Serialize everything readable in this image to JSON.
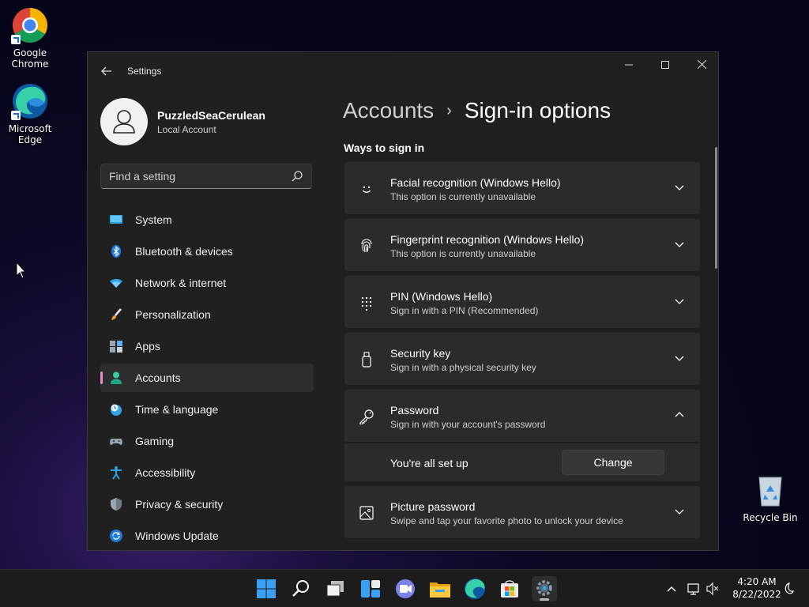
{
  "desktop": {
    "icons": [
      {
        "label_1": "Google",
        "label_2": "Chrome"
      },
      {
        "label_1": "Microsoft",
        "label_2": "Edge"
      },
      {
        "label_1": "Recycle Bin"
      }
    ]
  },
  "window": {
    "title": "Settings",
    "controls": {
      "minimize": "—",
      "maximize": "☐",
      "close": "✕"
    }
  },
  "profile": {
    "name": "PuzzledSeaCerulean",
    "account_type": "Local Account"
  },
  "search": {
    "placeholder": "Find a setting"
  },
  "sidebar": {
    "items": [
      {
        "label": "System",
        "icon": "monitor-icon"
      },
      {
        "label": "Bluetooth & devices",
        "icon": "bluetooth-icon"
      },
      {
        "label": "Network & internet",
        "icon": "wifi-icon"
      },
      {
        "label": "Personalization",
        "icon": "brush-icon"
      },
      {
        "label": "Apps",
        "icon": "apps-icon"
      },
      {
        "label": "Accounts",
        "icon": "person-icon",
        "active": true
      },
      {
        "label": "Time & language",
        "icon": "clock-globe-icon"
      },
      {
        "label": "Gaming",
        "icon": "gamepad-icon"
      },
      {
        "label": "Accessibility",
        "icon": "accessibility-icon"
      },
      {
        "label": "Privacy & security",
        "icon": "shield-icon"
      },
      {
        "label": "Windows Update",
        "icon": "update-icon"
      }
    ]
  },
  "breadcrumb": {
    "parent": "Accounts",
    "separator": "›",
    "current": "Sign-in options"
  },
  "section": {
    "title": "Ways to sign in"
  },
  "options": [
    {
      "title": "Facial recognition (Windows Hello)",
      "subtitle": "This option is currently unavailable",
      "icon": "face-icon"
    },
    {
      "title": "Fingerprint recognition (Windows Hello)",
      "subtitle": "This option is currently unavailable",
      "icon": "fingerprint-icon"
    },
    {
      "title": "PIN (Windows Hello)",
      "subtitle": "Sign in with a PIN (Recommended)",
      "icon": "keypad-icon"
    },
    {
      "title": "Security key",
      "subtitle": "Sign in with a physical security key",
      "icon": "usb-key-icon"
    },
    {
      "title": "Password",
      "subtitle": "Sign in with your account's password",
      "icon": "key-icon",
      "expanded": true
    },
    {
      "title": "Picture password",
      "subtitle": "Swipe and tap your favorite photo to unlock your device",
      "icon": "picture-icon"
    }
  ],
  "password_panel": {
    "status": "You're all set up",
    "button": "Change"
  },
  "taskbar": {
    "apps": [
      "start-icon",
      "search-icon",
      "task-view-icon",
      "widgets-icon",
      "chat-icon",
      "file-explorer-icon",
      "edge-icon",
      "store-icon",
      "settings-icon"
    ],
    "time": "4:20 AM",
    "date": "8/22/2022"
  },
  "colors": {
    "accent": "#e98fd0",
    "card_bg": "#2b2b2b",
    "window_bg": "#202020"
  }
}
